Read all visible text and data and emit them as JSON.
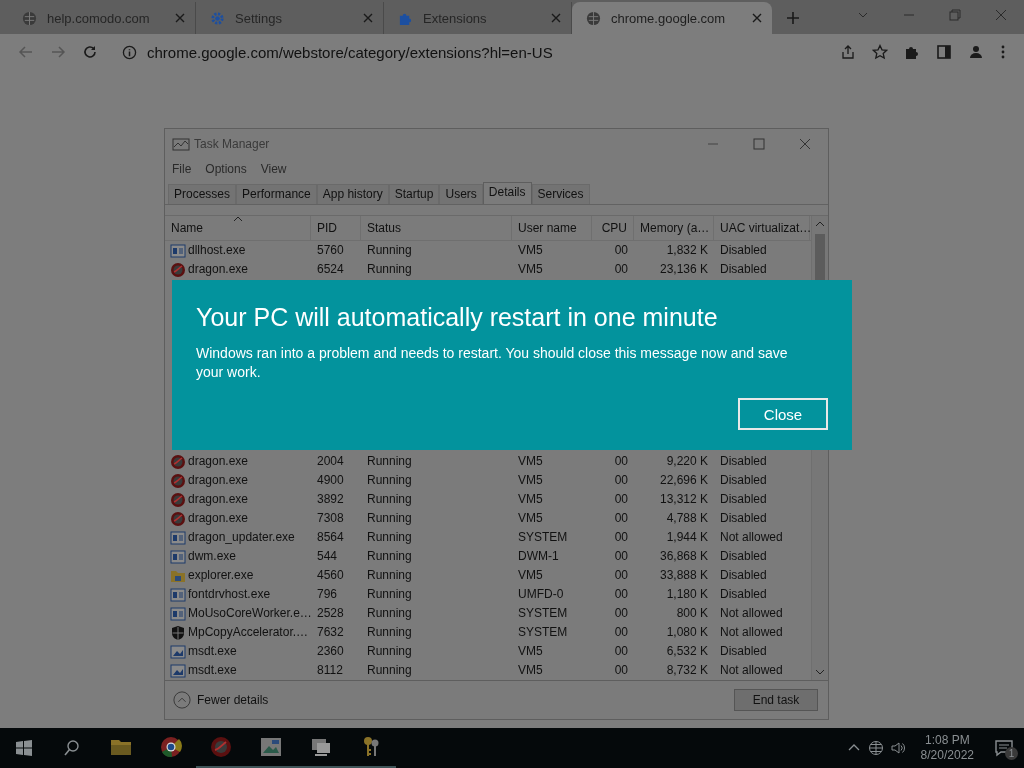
{
  "browser": {
    "tabs": [
      {
        "title": "help.comodo.com",
        "kind": "globe",
        "selected": false
      },
      {
        "title": "Settings",
        "kind": "gear",
        "selected": false
      },
      {
        "title": "Extensions",
        "kind": "puzzle",
        "selected": false
      },
      {
        "title": "chrome.google.com",
        "kind": "globe",
        "selected": true
      }
    ],
    "address": "chrome.google.com/webstore/category/extensions?hl=en-US"
  },
  "task_manager": {
    "title": "Task Manager",
    "menu": [
      "File",
      "Options",
      "View"
    ],
    "tabs": [
      {
        "label": "Processes",
        "selected": false
      },
      {
        "label": "Performance",
        "selected": false
      },
      {
        "label": "App history",
        "selected": false
      },
      {
        "label": "Startup",
        "selected": false
      },
      {
        "label": "Users",
        "selected": false
      },
      {
        "label": "Details",
        "selected": true
      },
      {
        "label": "Services",
        "selected": false
      }
    ],
    "columns": [
      "Name",
      "PID",
      "Status",
      "User name",
      "CPU",
      "Memory (a…",
      "UAC virtualizat…"
    ],
    "rows_above_dialog": [
      {
        "kind": "window",
        "cells": [
          "dllhost.exe",
          "5760",
          "Running",
          "VM5",
          "00",
          "1,832 K",
          "Disabled"
        ]
      },
      {
        "kind": "dragon",
        "cells": [
          "dragon.exe",
          "6524",
          "Running",
          "VM5",
          "00",
          "23,136 K",
          "Disabled"
        ]
      }
    ],
    "rows_below_dialog": [
      {
        "kind": "dragon",
        "cells": [
          "dragon.exe",
          "2004",
          "Running",
          "VM5",
          "00",
          "9,220 K",
          "Disabled"
        ]
      },
      {
        "kind": "dragon",
        "cells": [
          "dragon.exe",
          "4900",
          "Running",
          "VM5",
          "00",
          "22,696 K",
          "Disabled"
        ]
      },
      {
        "kind": "dragon",
        "cells": [
          "dragon.exe",
          "3892",
          "Running",
          "VM5",
          "00",
          "13,312 K",
          "Disabled"
        ]
      },
      {
        "kind": "dragon",
        "cells": [
          "dragon.exe",
          "7308",
          "Running",
          "VM5",
          "00",
          "4,788 K",
          "Disabled"
        ]
      },
      {
        "kind": "window",
        "cells": [
          "dragon_updater.exe",
          "8564",
          "Running",
          "SYSTEM",
          "00",
          "1,944 K",
          "Not allowed"
        ]
      },
      {
        "kind": "window",
        "cells": [
          "dwm.exe",
          "544",
          "Running",
          "DWM-1",
          "00",
          "36,868 K",
          "Disabled"
        ]
      },
      {
        "kind": "folder",
        "cells": [
          "explorer.exe",
          "4560",
          "Running",
          "VM5",
          "00",
          "33,888 K",
          "Disabled"
        ]
      },
      {
        "kind": "window",
        "cells": [
          "fontdrvhost.exe",
          "796",
          "Running",
          "UMFD-0",
          "00",
          "1,180 K",
          "Disabled"
        ]
      },
      {
        "kind": "window",
        "cells": [
          "MoUsoCoreWorker.e…",
          "2528",
          "Running",
          "SYSTEM",
          "00",
          "800 K",
          "Not allowed"
        ]
      },
      {
        "kind": "shield",
        "cells": [
          "MpCopyAccelerator.…",
          "7632",
          "Running",
          "SYSTEM",
          "00",
          "1,080 K",
          "Not allowed"
        ]
      },
      {
        "kind": "image",
        "cells": [
          "msdt.exe",
          "2360",
          "Running",
          "VM5",
          "00",
          "6,532 K",
          "Disabled"
        ]
      },
      {
        "kind": "image",
        "cells": [
          "msdt.exe",
          "8112",
          "Running",
          "VM5",
          "00",
          "8,732 K",
          "Not allowed"
        ]
      }
    ],
    "fewer_details": "Fewer details",
    "end_task": "End task"
  },
  "dialog": {
    "title": "Your PC will automatically restart in one minute",
    "message": "Windows ran into a problem and needs to restart. You should close this message now and save your work.",
    "button": "Close"
  },
  "taskbar": {
    "apps": [
      {
        "kind": "folder",
        "running": false
      },
      {
        "kind": "chrome",
        "running": false
      },
      {
        "kind": "dragon",
        "running": true
      },
      {
        "kind": "image",
        "running": true
      },
      {
        "kind": "monitor",
        "running": true
      },
      {
        "kind": "keys",
        "running": true
      }
    ],
    "time": "1:08 PM",
    "date": "8/20/2022",
    "notifications": "1"
  }
}
